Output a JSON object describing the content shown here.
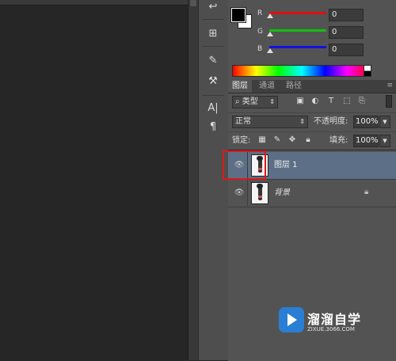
{
  "colors": {
    "foreground": "#000000",
    "background": "#ffffff",
    "r_track": "#e01010",
    "g_track": "#10c010",
    "b_track": "#1010e0",
    "selection_blue": "#5d6f86",
    "highlight_red": "#e01818"
  },
  "color_panel": {
    "r_label": "R",
    "r_value": "0",
    "g_label": "G",
    "g_value": "0",
    "b_label": "B",
    "b_value": "0"
  },
  "layers_panel": {
    "tabs": [
      "图层",
      "通道",
      "路径"
    ],
    "menu_icon": "panel-menu-icon",
    "filter_kind": "类型",
    "filter_icon": "search-icon",
    "blend_mode": "正常",
    "opacity_label": "不透明度:",
    "opacity_value": "100%",
    "lock_label": "锁定:",
    "fill_label": "填充:",
    "fill_value": "100%"
  },
  "layers": [
    {
      "name": "图层 1",
      "visible": true,
      "selected": true
    },
    {
      "name": "背景",
      "visible": true,
      "selected": false,
      "locked": true
    }
  ],
  "toolstrip": {
    "text_tool": "A|",
    "paragraph_tool": "¶"
  },
  "watermark": {
    "title": "溜溜自学",
    "url": "ZIXUE.3066.COM"
  }
}
